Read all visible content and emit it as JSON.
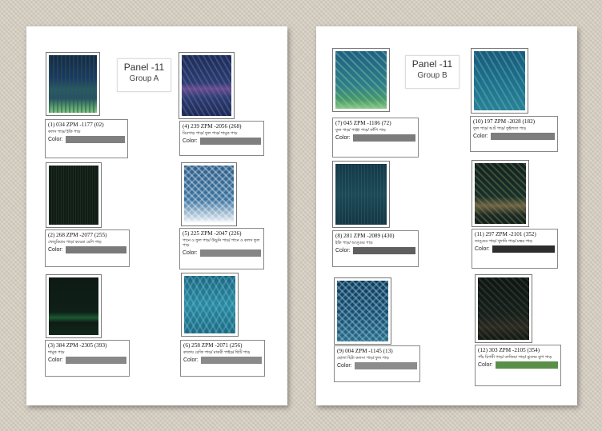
{
  "panel_a": {
    "title": "Panel -11",
    "group": "Group A",
    "items": [
      {
        "code": "(1) 034 ZPM -1177 (02)",
        "desc": "কলস পাড়/ ইকি পাড়",
        "color_label": "Color:",
        "color": "#808080"
      },
      {
        "code": "(4) 239 ZPM -2056 (268)",
        "desc": "মিরপাড় পাড়/ ফুল পাড়/ শামুক পাড়",
        "color_label": "Color:",
        "color": "#7f7f7f"
      },
      {
        "code": "(2) 268 ZPM -2077 (255)",
        "desc": "খেজুরিয়াম পাড়/ কয়েরা রেশি পাড়",
        "color_label": "Color:",
        "color": "#7a7a7a"
      },
      {
        "code": "(5) 225 ZPM -2047 (226)",
        "desc": "পানে ও ফুল পাড়/ উড়ুনি পাড়/ পানে ও কলস ফুল পাড়",
        "color_label": "Color:",
        "color": "#858585"
      },
      {
        "code": "(3) 384 ZPM -2305 (393)",
        "desc": "শামুক পাড়",
        "color_label": "Color:",
        "color": "#888888"
      },
      {
        "code": "(6) 258 ZPM -2071 (256)",
        "desc": "কাতায় রেজি পাড়/ মাকরী পাইড়/ ছিটি পাড়",
        "color_label": "Color:",
        "color": "#8a8a8a"
      }
    ]
  },
  "panel_b": {
    "title": "Panel -11",
    "group": "Group B",
    "items": [
      {
        "code": "(7) 045 ZPM -1186 (72)",
        "desc": "ফুল পাড়/ পাঞ্জা পাড়/ ফাঁপি পাড়",
        "color_label": "Color:",
        "color": "#7c7c7c"
      },
      {
        "code": "(10) 197 ZPM -2028 (182)",
        "desc": "ফুল পাড়/ আট পাড়/ ফুইলতা পাড়",
        "color_label": "Color:",
        "color": "#7d7d7d"
      },
      {
        "code": "(8) 281 ZPM -2089 (430)",
        "desc": "ইকি পাড়/ আঙ্গুর পাড়",
        "color_label": "Color:",
        "color": "#5f5f5f"
      },
      {
        "code": "(11) 297 ZPM -2101 (352)",
        "desc": "তাঙ্গুর পাড়/ খুদানি পাড়/ মস্কর পাড়",
        "color_label": "Color:",
        "color": "#2c2c2c"
      },
      {
        "code": "(9) 004 ZPM -1145 (13)",
        "desc": "ছোলা ছিটা কলসা পাড়/ ফুল পাড়",
        "color_label": "Color:",
        "color": "#8c8c8c"
      },
      {
        "code": "(12) 303 ZPM -2105 (354)",
        "desc": "পাঁচ চিপনী পাড়/ তাজিয়া পাড়/ ঝুলের ঝুপ পাড়",
        "color_label": "Color:",
        "color": "#5a8f4a"
      }
    ]
  }
}
